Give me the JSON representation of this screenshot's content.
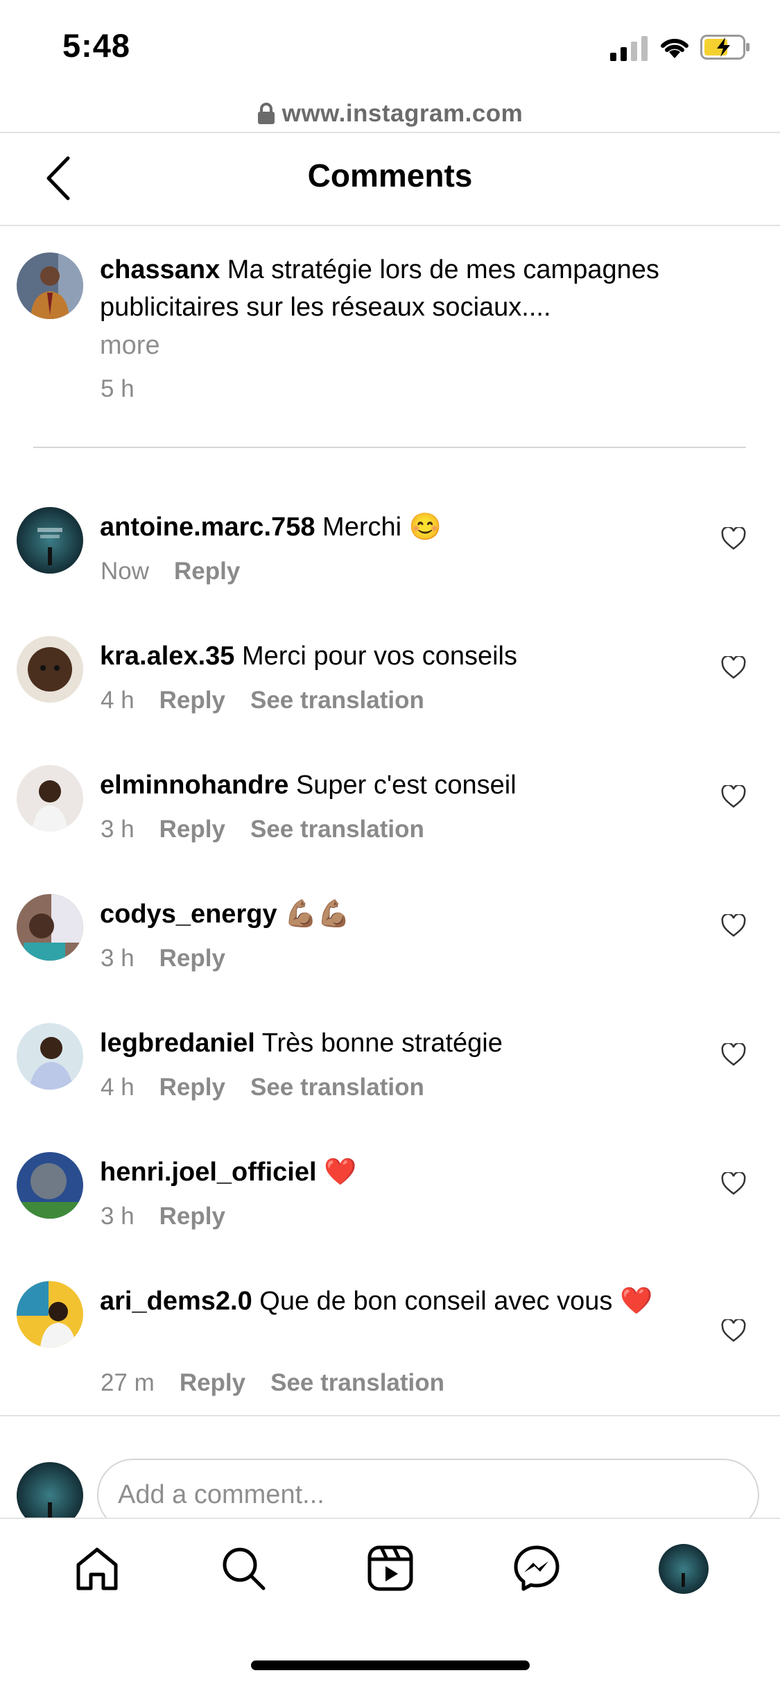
{
  "status_bar": {
    "time": "5:48"
  },
  "browser": {
    "url": "www.instagram.com"
  },
  "header": {
    "title": "Comments"
  },
  "caption": {
    "username": "chassanx",
    "text": "Ma stratégie lors de mes campagnes publicitaires sur les réseaux sociaux....",
    "more_label": "more",
    "time": "5 h"
  },
  "comments": [
    {
      "username": "antoine.marc.758",
      "text": "Merchi 😊",
      "time": "Now",
      "reply": "Reply",
      "translate": ""
    },
    {
      "username": "kra.alex.35",
      "text": "Merci pour vos conseils",
      "time": "4 h",
      "reply": "Reply",
      "translate": "See translation"
    },
    {
      "username": "elminnohandre",
      "text": "Super c'est conseil",
      "time": "3 h",
      "reply": "Reply",
      "translate": "See translation"
    },
    {
      "username": "codys_energy",
      "text": "💪🏽💪🏽",
      "time": "3 h",
      "reply": "Reply",
      "translate": ""
    },
    {
      "username": "legbredaniel",
      "text": "Très bonne stratégie",
      "time": "4 h",
      "reply": "Reply",
      "translate": "See translation"
    },
    {
      "username": "henri.joel_officiel",
      "text": "❤️",
      "time": "3 h",
      "reply": "Reply",
      "translate": ""
    },
    {
      "username": "ari_dems2.0",
      "text": "Que de bon conseil avec vous ❤️",
      "time": "27 m",
      "reply": "Reply",
      "translate": "See translation"
    }
  ],
  "composer": {
    "placeholder": "Add a comment..."
  },
  "nav": {
    "items": [
      "home-icon",
      "search-icon",
      "reels-icon",
      "messenger-icon",
      "profile-avatar"
    ]
  },
  "colors": {
    "meta": "#8a8a8a",
    "divider": "#e3e3e3",
    "text": "#000000"
  }
}
